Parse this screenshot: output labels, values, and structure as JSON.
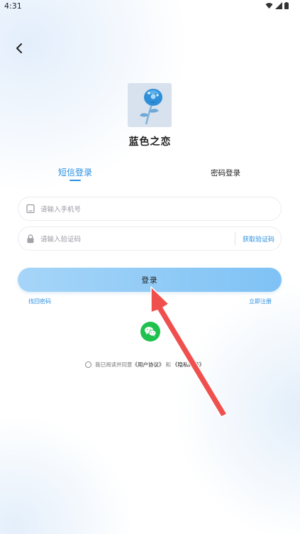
{
  "status_bar": {
    "time": "4:31"
  },
  "app": {
    "name": "蓝色之恋"
  },
  "tabs": {
    "sms": "短信登录",
    "password": "密码登录"
  },
  "phone_field": {
    "placeholder": "请输入手机号"
  },
  "code_field": {
    "placeholder": "请输入验证码",
    "get_code_label": "获取验证码"
  },
  "login_button": {
    "label": "登录"
  },
  "links": {
    "forgot_password": "找回密码",
    "register": "立即注册"
  },
  "agreement": {
    "prefix": "我已阅读并同意",
    "user_agreement": "《用户协议》",
    "and": "和",
    "privacy_policy": "《隐私政策》"
  },
  "colors": {
    "accent": "#2a8fe0",
    "button_gradient_start": "#a6d5f8",
    "button_gradient_end": "#7fc2f5",
    "wechat": "#1fc24f",
    "annotation_arrow": "#f0504d"
  },
  "icons": {
    "back": "chevron-left-icon",
    "phone": "phone-icon",
    "lock": "lock-icon",
    "wechat": "wechat-icon"
  }
}
